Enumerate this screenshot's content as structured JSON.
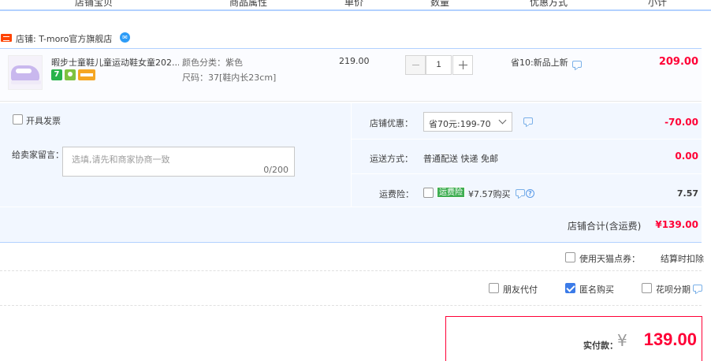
{
  "header": {
    "columns": [
      "店铺宝贝",
      "商品属性",
      "单价",
      "数量",
      "优惠方式",
      "小计"
    ]
  },
  "shop": {
    "badge_icon": "tmall-icon",
    "label": "店铺: T-moro官方旗舰店",
    "chat_icon": "wangwang-icon"
  },
  "item": {
    "title": "暇步士童鞋儿童运动鞋女童202...",
    "attr_color": "颜色分类：紫色",
    "attr_size": "尺码：37[鞋内长23cm]",
    "unit_price": "219.00",
    "quantity": "1",
    "service_7": "7",
    "promo": "省10:新品上新",
    "subtotal": "209.00"
  },
  "order": {
    "invoice_label": "开具发票",
    "message_label": "给卖家留言：",
    "message_placeholder": "选填,请先和商家协商一致",
    "message_count": "0/200",
    "shop_discount_label": "店铺优惠：",
    "shop_discount_selected": "省70元:199-70",
    "shop_discount_amount": "-70.00",
    "shipping_label": "运送方式：",
    "shipping_value": "普通配送 快递 免邮",
    "shipping_amount": "0.00",
    "insurance_label": "运费险：",
    "insurance_tag": "运费险",
    "insurance_value": "¥7.57购买",
    "insurance_amount": "7.57",
    "shop_total_label": "店铺合计(含运费)",
    "shop_total": "¥139.00"
  },
  "options": {
    "tmall_points_label": "使用天猫点券：",
    "tmall_points_note": "结算时扣除",
    "friend_pay": "朋友代付",
    "anonymous": "匿名购买",
    "anonymous_checked": true,
    "huabei": "花呗分期"
  },
  "payment": {
    "label": "实付款：",
    "currency": "¥",
    "amount": "139.00"
  },
  "colors": {
    "accent_red": "#ff0036",
    "accent_blue": "#b2d1ff",
    "panel_bg": "#f2f7ff"
  }
}
